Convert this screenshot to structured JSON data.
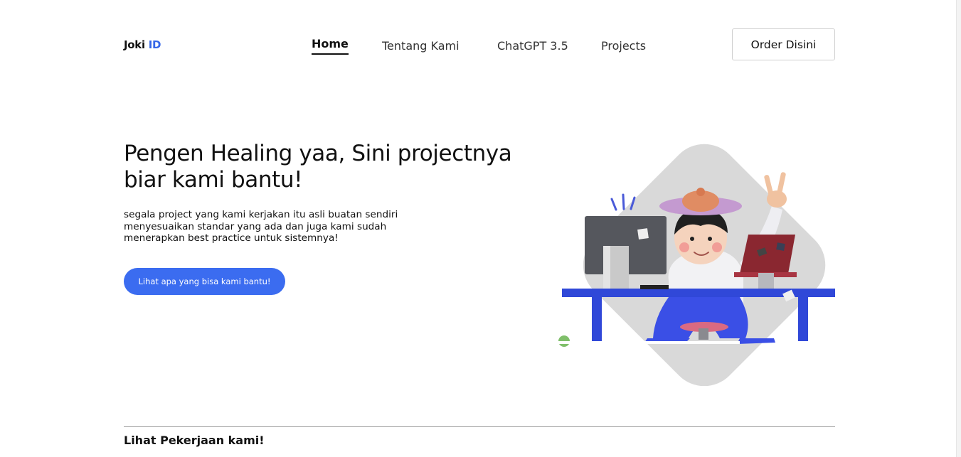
{
  "header": {
    "logo_main": "Joki",
    "logo_accent": "ID",
    "nav": [
      {
        "label": "Home",
        "active": true
      },
      {
        "label": "Tentang Kami",
        "active": false
      },
      {
        "label": "ChatGPT 3.5",
        "active": false
      },
      {
        "label": "Projects",
        "active": false
      }
    ],
    "order_button": "Order Disini"
  },
  "hero": {
    "title_line1": "Pengen Healing yaa, Sini projectnya",
    "title_line2": "biar kami bantu!",
    "desc_line1": "segala project yang kami kerjakan itu asli buatan sendiri",
    "desc_line2": "menyesuaikan standar yang ada dan juga kami sudah",
    "desc_line3": "menerapkan best practice untuk sistemnya!",
    "cta_button": "Lihat apa yang bisa kami bantu!",
    "illustration_icon": "person-at-desk-illustration"
  },
  "works": {
    "title": "Lihat Pekerjaan kami!"
  },
  "colors": {
    "accent": "#3566e8",
    "cta": "#3b6cf0",
    "desk_blue": "#3048d8",
    "backdrop_gray": "#d9d9d9"
  }
}
